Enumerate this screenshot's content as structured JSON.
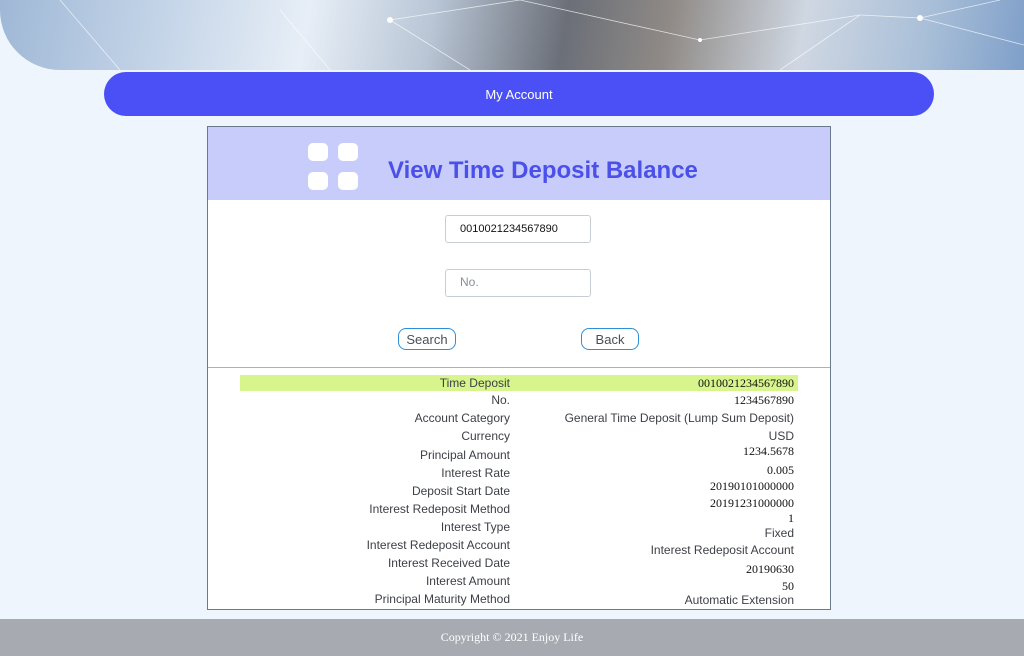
{
  "nav": {
    "my_account": "My Account"
  },
  "panel": {
    "title": "View Time Deposit Balance"
  },
  "form": {
    "account_value": "0010021234567890",
    "no_placeholder": "No.",
    "search_label": "Search",
    "back_label": "Back"
  },
  "details": [
    {
      "label": "Time Deposit",
      "value": "0010021234567890"
    },
    {
      "label": "No.",
      "value": "1234567890"
    },
    {
      "label": "Account Category",
      "value": "General Time Deposit (Lump Sum Deposit)"
    },
    {
      "label": "Currency",
      "value": "USD"
    },
    {
      "label": "Principal Amount",
      "value": "1234.5678"
    },
    {
      "label": "Interest Rate",
      "value": "0.005"
    },
    {
      "label": "Deposit Start Date",
      "value": "20190101000000"
    },
    {
      "label": "Interest Redeposit Method",
      "value": "20191231000000"
    },
    {
      "label": "Interest Type",
      "value": "1"
    },
    {
      "label": "Interest Redeposit Account",
      "value": "Fixed"
    },
    {
      "label": "Interest Received Date",
      "value": "Interest Redeposit Account"
    },
    {
      "label": "Interest Amount",
      "value": "20190630"
    },
    {
      "label": "Principal Maturity Method",
      "value": "50"
    },
    {
      "label": "",
      "value": "Automatic Extension"
    }
  ],
  "footer": {
    "copyright": "Copyright  © 2021 Enjoy Life"
  },
  "colors": {
    "accent": "#4a50f5",
    "header_bg": "#c7ccfb",
    "highlight": "#d7f58c",
    "footer_bg": "#a7abb1"
  }
}
